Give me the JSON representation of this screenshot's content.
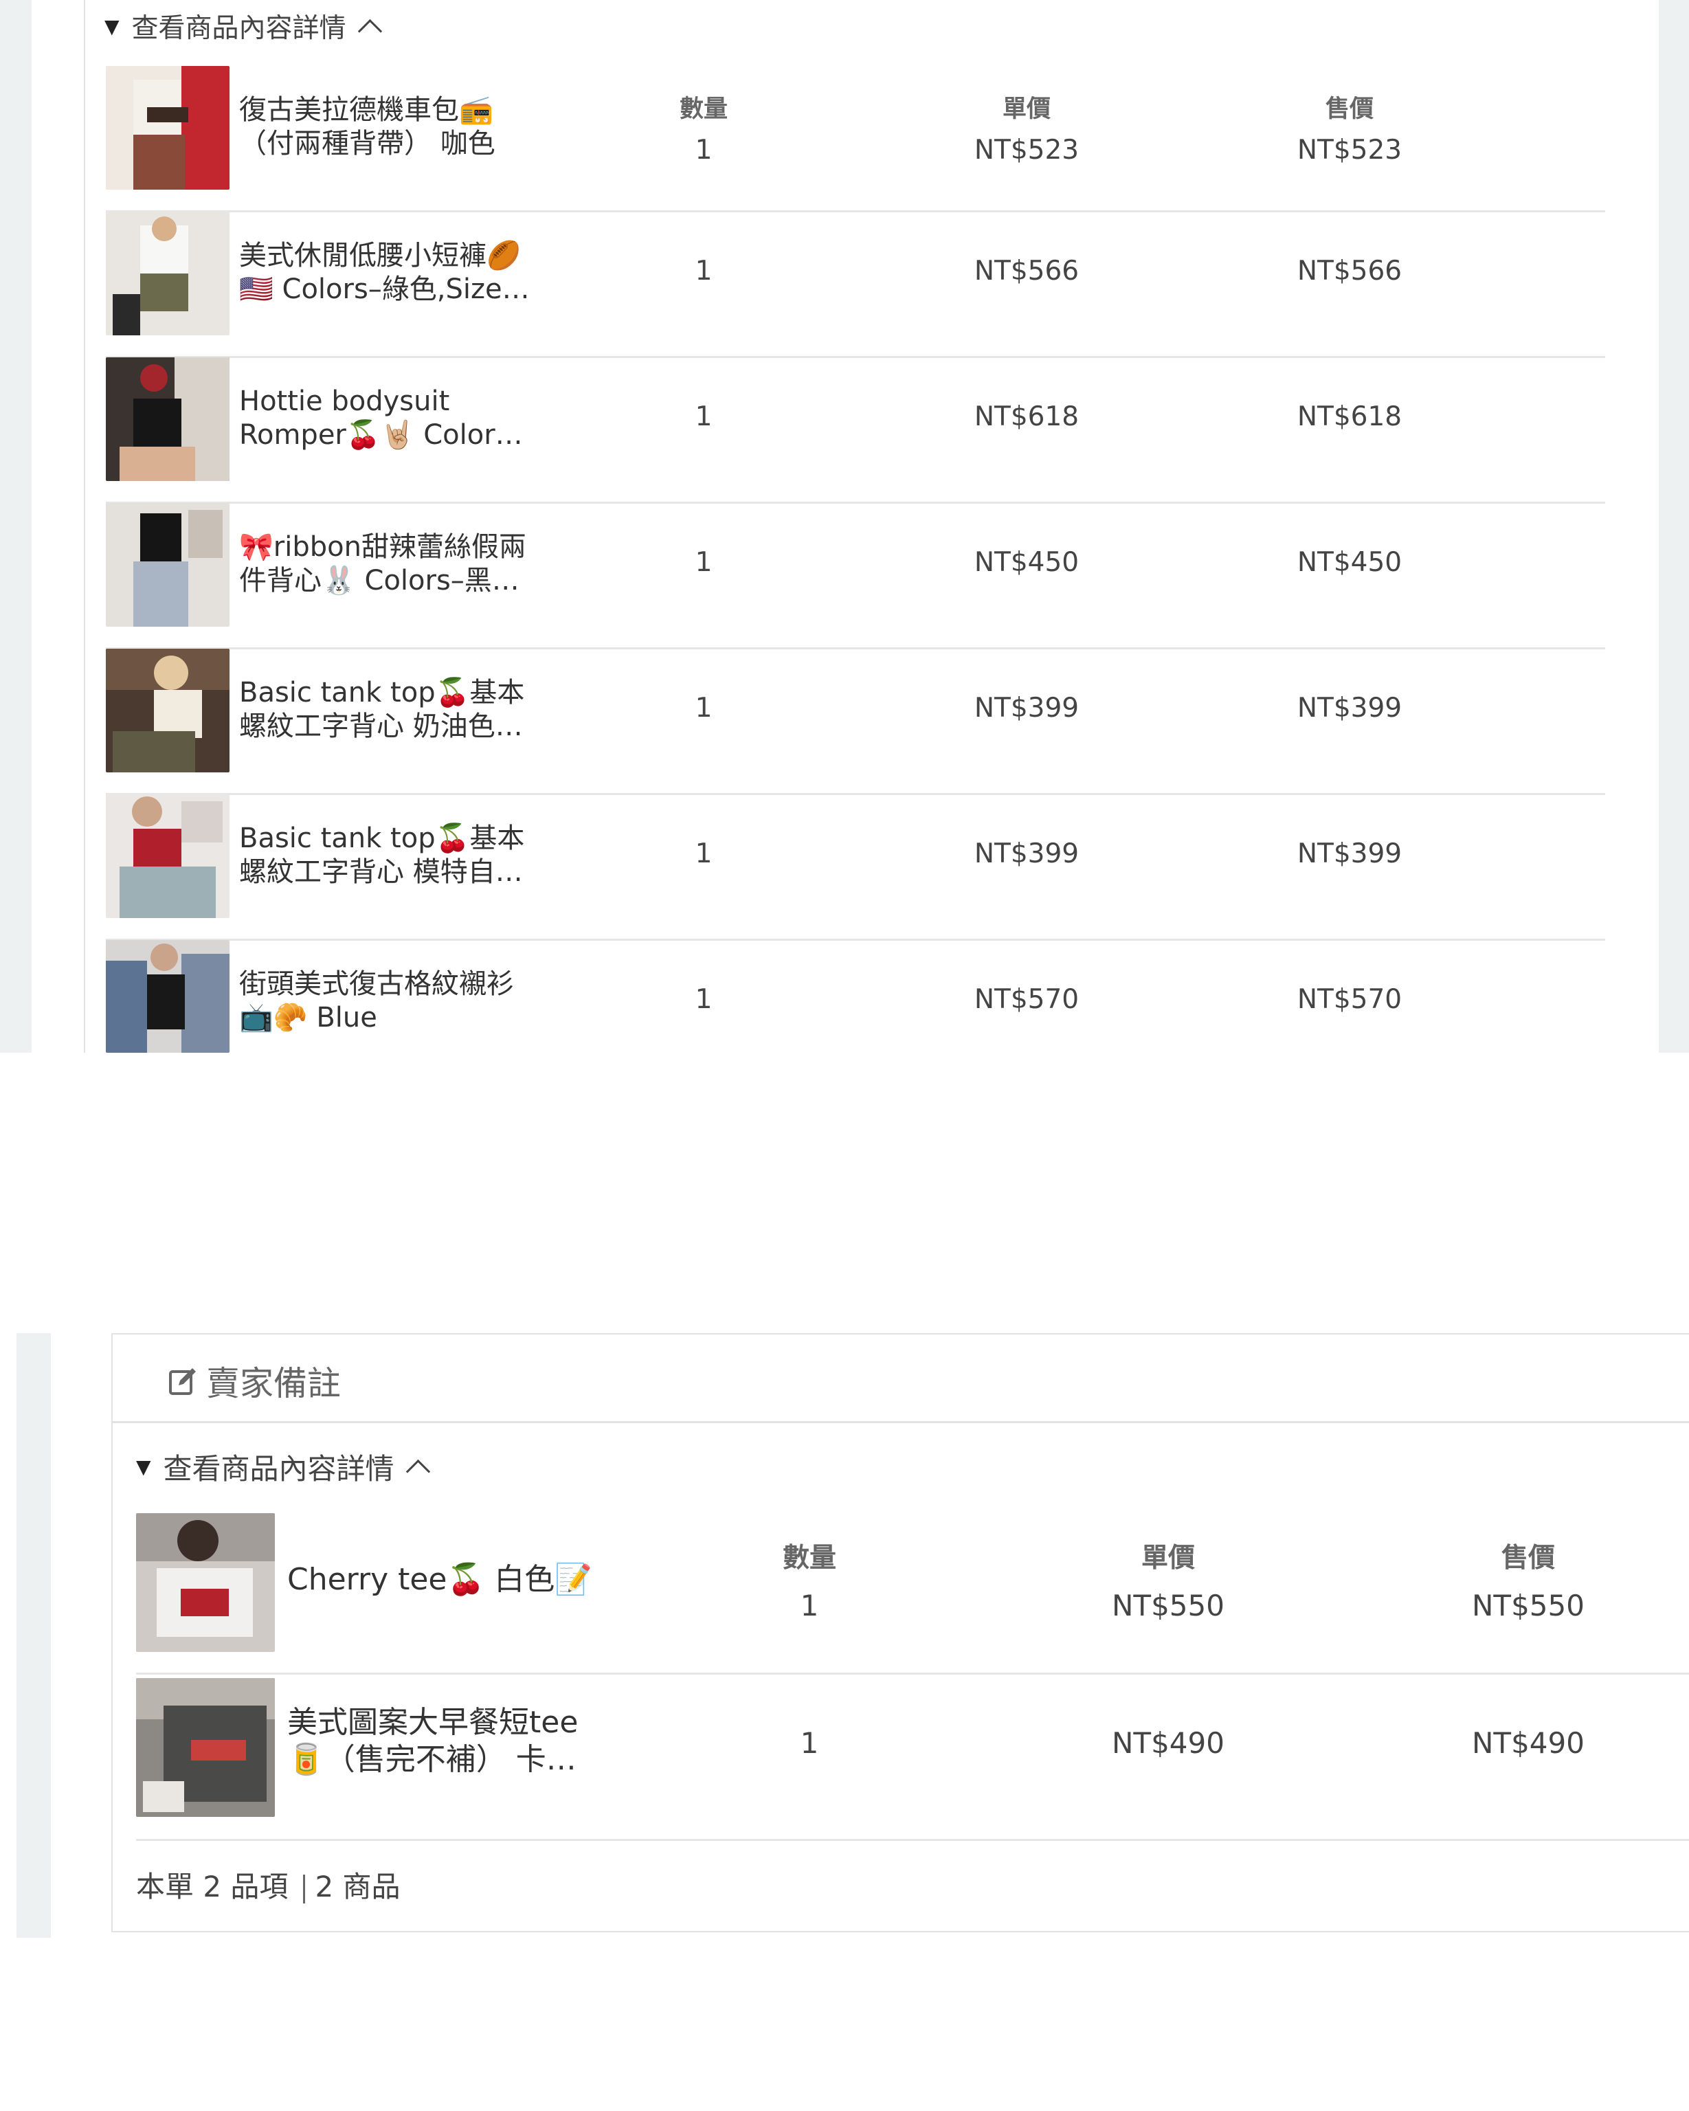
{
  "panel1": {
    "details_toggle": "查看商品內容詳情",
    "headers": {
      "qty": "數量",
      "unit_price": "單價",
      "sale_price": "售價"
    },
    "items": [
      {
        "line1": "復古美拉德機車包📻",
        "line2": "（付兩種背帶） 咖色",
        "qty": "1",
        "unit_price": "NT$523",
        "sale_price": "NT$523"
      },
      {
        "line1": "美式休閒低腰小短褲🏉",
        "line2": "🇺🇸 Colors–綠色,Size…",
        "qty": "1",
        "unit_price": "NT$566",
        "sale_price": "NT$566"
      },
      {
        "line1": "Hottie bodysuit",
        "line2": "Romper🍒🤘🏼 Color…",
        "qty": "1",
        "unit_price": "NT$618",
        "sale_price": "NT$618"
      },
      {
        "line1": "🎀ribbon甜辣蕾絲假兩",
        "line2": "件背心🐰 Colors–黑…",
        "qty": "1",
        "unit_price": "NT$450",
        "sale_price": "NT$450"
      },
      {
        "line1": "Basic tank top🍒基本",
        "line2": "螺紋工字背心 奶油色…",
        "qty": "1",
        "unit_price": "NT$399",
        "sale_price": "NT$399"
      },
      {
        "line1": "Basic tank top🍒基本",
        "line2": "螺紋工字背心 模特自…",
        "qty": "1",
        "unit_price": "NT$399",
        "sale_price": "NT$399"
      },
      {
        "line1": "街頭美式復古格紋襯衫",
        "line2": "📺🥐 Blue",
        "qty": "1",
        "unit_price": "NT$570",
        "sale_price": "NT$570"
      }
    ]
  },
  "panel2": {
    "seller_note": "賣家備註",
    "details_toggle": "查看商品內容詳情",
    "headers": {
      "qty": "數量",
      "unit_price": "單價",
      "sale_price": "售價"
    },
    "items": [
      {
        "line1": "Cherry tee🍒 白色📝",
        "line2": "",
        "qty": "1",
        "unit_price": "NT$550",
        "sale_price": "NT$550"
      },
      {
        "line1": "美式圖案大早餐短tee",
        "line2": "🥫（售完不補） 卡…",
        "qty": "1",
        "unit_price": "NT$490",
        "sale_price": "NT$490"
      }
    ],
    "summary": {
      "part1": "本單 2 品項",
      "part2": "2 商品"
    }
  },
  "colors": {
    "panel_bg": "#ffffff",
    "side_bar": "#eef1f1",
    "divider": "#e6e6e6",
    "text": "#333333",
    "header_text": "#666666"
  },
  "icons": {
    "expand": "triangle-down-icon",
    "collapse": "chevron-up-icon",
    "note": "edit-icon"
  }
}
